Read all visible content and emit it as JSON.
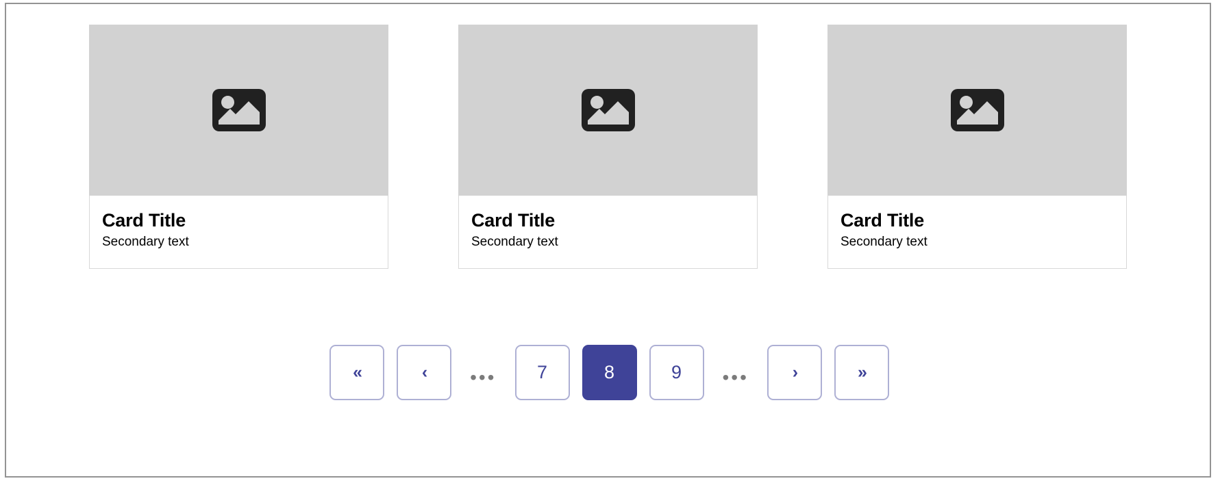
{
  "page": {
    "background_color": "#ffffff",
    "frame_border_color": "#939393"
  },
  "cards": [
    {
      "media_icon": "image-placeholder-icon",
      "media_background": "#d2d2d2",
      "title": "Card Title",
      "subtitle": "Secondary text"
    },
    {
      "media_icon": "image-placeholder-icon",
      "media_background": "#d2d2d2",
      "title": "Card Title",
      "subtitle": "Secondary text"
    },
    {
      "media_icon": "image-placeholder-icon",
      "media_background": "#d2d2d2",
      "title": "Card Title",
      "subtitle": "Secondary text"
    }
  ],
  "pagination": {
    "accent_color": "#3f4398",
    "border_color": "#aeb0d4",
    "current_page": "8",
    "items": [
      {
        "type": "first",
        "label": "«",
        "icon": "double-chevron-left-icon",
        "active": false
      },
      {
        "type": "prev",
        "label": "‹",
        "icon": "chevron-left-icon",
        "active": false
      },
      {
        "type": "ellipsis",
        "label": "•••",
        "icon": "ellipsis-icon",
        "active": false
      },
      {
        "type": "page",
        "label": "7",
        "icon": "",
        "active": false
      },
      {
        "type": "page",
        "label": "8",
        "icon": "",
        "active": true
      },
      {
        "type": "page",
        "label": "9",
        "icon": "",
        "active": false
      },
      {
        "type": "ellipsis",
        "label": "•••",
        "icon": "ellipsis-icon",
        "active": false
      },
      {
        "type": "next",
        "label": "›",
        "icon": "chevron-right-icon",
        "active": false
      },
      {
        "type": "last",
        "label": "»",
        "icon": "double-chevron-right-icon",
        "active": false
      }
    ]
  }
}
